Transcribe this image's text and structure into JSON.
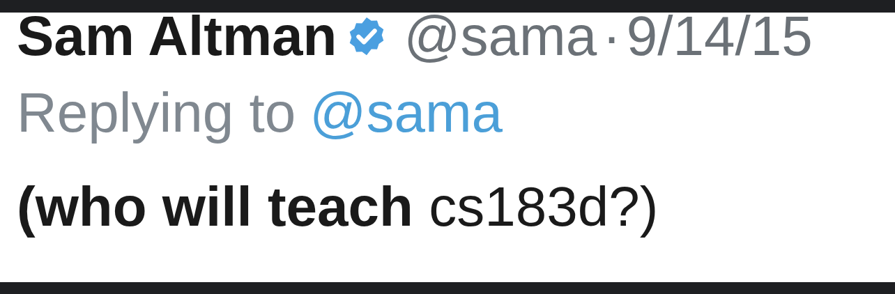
{
  "tweet": {
    "author": {
      "name": "Sam Altman",
      "verified": true,
      "handle": "@sama"
    },
    "separator": "·",
    "date": "9/14/15",
    "reply_prefix": "Replying to",
    "reply_to": "@sama",
    "text": "**(who will teach** cs183d?)"
  }
}
